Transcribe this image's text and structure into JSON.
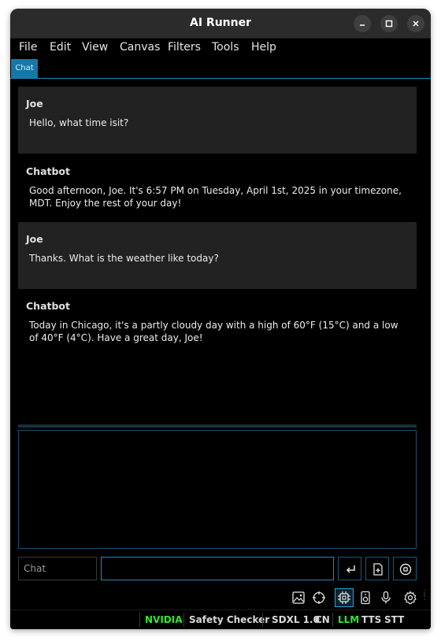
{
  "window": {
    "title": "AI Runner"
  },
  "menu": [
    "File",
    "Edit",
    "View",
    "Canvas",
    "Filters",
    "Tools",
    "Help"
  ],
  "tabs": [
    {
      "label": "Chat",
      "active": true
    }
  ],
  "messages": [
    {
      "author": "Joe",
      "role": "user",
      "text": "Hello, what time isit?"
    },
    {
      "author": "Chatbot",
      "role": "bot",
      "text": " Good afternoon, Joe. It's 6:57 PM on Tuesday, April 1st, 2025 in your timezone, MDT. Enjoy the rest of your day!"
    },
    {
      "author": "Joe",
      "role": "user",
      "text": "Thanks. What is the weather like today?"
    },
    {
      "author": "Chatbot",
      "role": "bot",
      "text": " Today in Chicago, it's a partly cloudy day with a high of 60°F (15°C) and a low of 40°F (4°C). Have a great day, Joe!"
    }
  ],
  "input": {
    "mode": "Chat",
    "value": ""
  },
  "toolbar_icons": [
    "image-icon",
    "crosshair-icon",
    "chip-icon",
    "speaker-icon",
    "microphone-icon",
    "settings-icon"
  ],
  "status": {
    "gpu": "NVIDIA",
    "safety": "Safety Checker",
    "model": "SDXL 1.0",
    "cn": "CN",
    "llm": "LLM",
    "tts": "TTS",
    "stt": "STT"
  },
  "colors": {
    "accent": "#2a9ed2",
    "active_green": "#2ee82e",
    "user_bubble": "#222222",
    "background": "#000000"
  }
}
